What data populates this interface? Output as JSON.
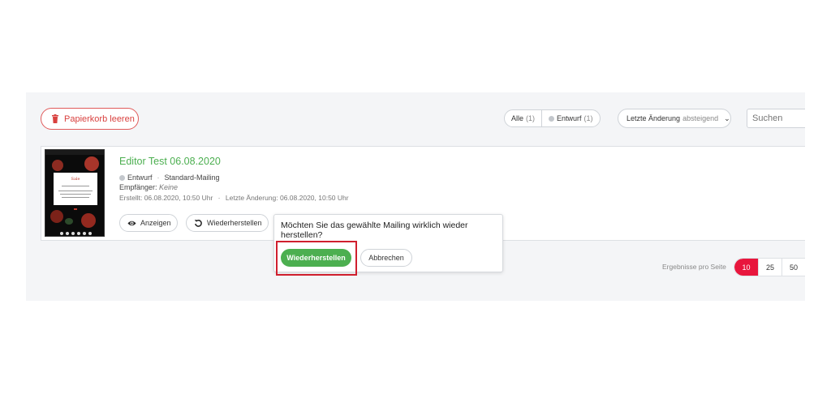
{
  "toolbar": {
    "empty_trash_label": "Papierkorb leeren",
    "filters": [
      {
        "label": "Alle",
        "count": "(1)"
      },
      {
        "label": "Entwurf",
        "count": "(1)"
      }
    ],
    "sort_label": "Letzte Änderung",
    "sort_direction": "absteigend",
    "search_placeholder": "Suchen"
  },
  "mailing": {
    "title": "Editor Test 06.08.2020",
    "status": "Entwurf",
    "separator": "·",
    "type": "Standard-Mailing",
    "recipients_label": "Empfänger:",
    "recipients_value": "Keine",
    "created": "Erstellt: 06.08.2020, 10:50 Uhr",
    "modified": "Letzte Änderung: 06.08.2020, 10:50 Uhr",
    "view_button": "Anzeigen",
    "restore_button": "Wiederherstellen",
    "thumbnail": {
      "script_text": "Sale",
      "date_text": "17. September 2020"
    }
  },
  "confirm_dialog": {
    "message": "Möchten Sie das gewählte Mailing wirklich wieder herstellen?",
    "confirm_label": "Wiederherstellen",
    "cancel_label": "Abbrechen"
  },
  "pagination": {
    "label": "Ergebnisse pro Seite",
    "options": [
      "10",
      "25",
      "50"
    ],
    "selected": "10"
  },
  "colors": {
    "accent_green": "#4caf50",
    "accent_red": "#e8163d",
    "trash_red": "#d9413f",
    "highlight_red": "#d01f2e",
    "panel_bg": "#f4f5f7"
  }
}
